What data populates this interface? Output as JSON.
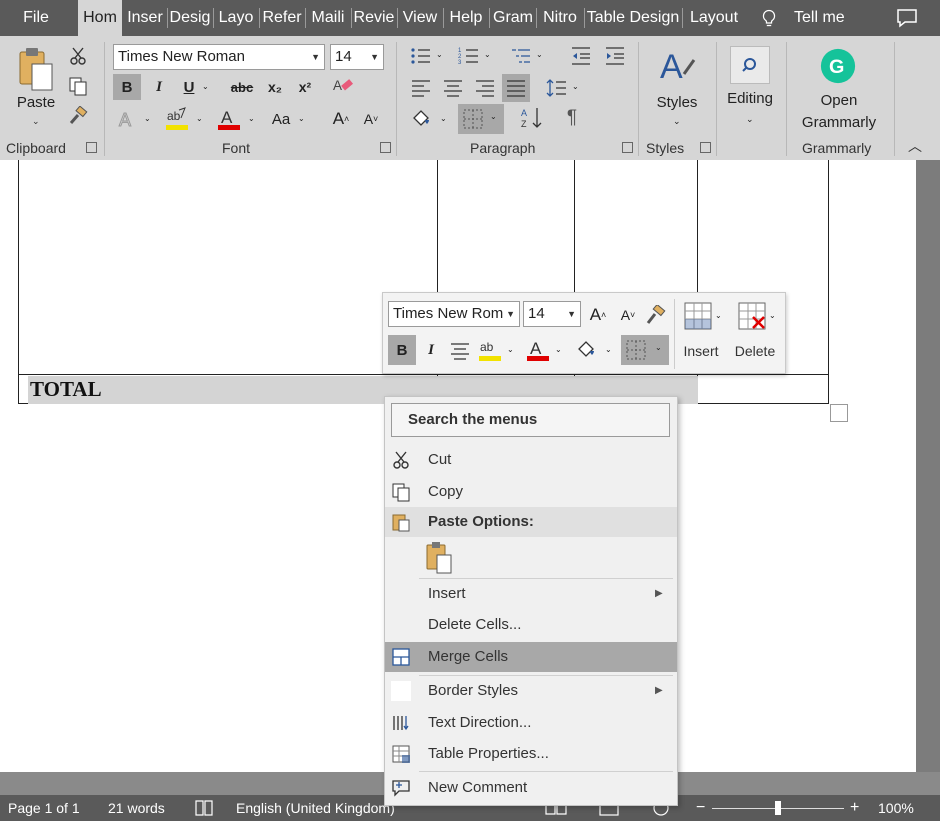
{
  "tabs": [
    {
      "label": "File",
      "active": false
    },
    {
      "label": "Hom",
      "active": true
    },
    {
      "label": "Inser",
      "active": false
    },
    {
      "label": "Desig",
      "active": false
    },
    {
      "label": "Layo",
      "active": false
    },
    {
      "label": "Refer",
      "active": false
    },
    {
      "label": "Maili",
      "active": false
    },
    {
      "label": "Revie",
      "active": false
    },
    {
      "label": "View",
      "active": false
    },
    {
      "label": "Help",
      "active": false
    },
    {
      "label": "Gram",
      "active": false
    },
    {
      "label": "Nitro",
      "active": false
    },
    {
      "label": "Table Design",
      "active": false
    },
    {
      "label": "Layout",
      "active": false
    }
  ],
  "tell_me": "Tell me",
  "ribbon": {
    "clipboard": {
      "paste_label": "Paste",
      "group_label": "Clipboard"
    },
    "font": {
      "font_name": "Times New Roman",
      "font_size": "14",
      "bold": "B",
      "italic": "I",
      "underline": "U",
      "strike": "abc",
      "subscript": "x₂",
      "superscript": "x²",
      "case_label": "Aa",
      "group_label": "Font"
    },
    "paragraph": {
      "group_label": "Paragraph"
    },
    "styles": {
      "label": "Styles",
      "group_label": "Styles"
    },
    "editing": {
      "label": "Editing"
    },
    "grammarly": {
      "label_line1": "Open",
      "label_line2": "Grammarly",
      "group_label": "Grammarly"
    }
  },
  "document": {
    "total_label": "TOTAL"
  },
  "mini_toolbar": {
    "font_name": "Times New Rom",
    "font_size": "14",
    "insert_label": "Insert",
    "delete_label": "Delete",
    "bold": "B",
    "italic": "I"
  },
  "context_menu": {
    "search": "Search the menus",
    "cut": "Cut",
    "copy": "Copy",
    "paste_options": "Paste Options:",
    "insert": "Insert",
    "delete_cells": "Delete Cells...",
    "merge_cells": "Merge Cells",
    "border_styles": "Border Styles",
    "text_direction": "Text Direction...",
    "table_properties": "Table Properties...",
    "new_comment": "New Comment"
  },
  "status": {
    "page": "Page 1 of 1",
    "words": "21 words",
    "language": "English (United Kingdom)",
    "zoom": "100%",
    "zoom_minus": "−",
    "zoom_plus": "+"
  },
  "colors": {
    "tabbar": "#5a5a5a",
    "ribbon": "#d6d6d6",
    "highlight_yellow": "#f2e200",
    "font_red": "#e00000",
    "grammarly_green": "#15c39a",
    "styles_blue": "#2b579a"
  }
}
